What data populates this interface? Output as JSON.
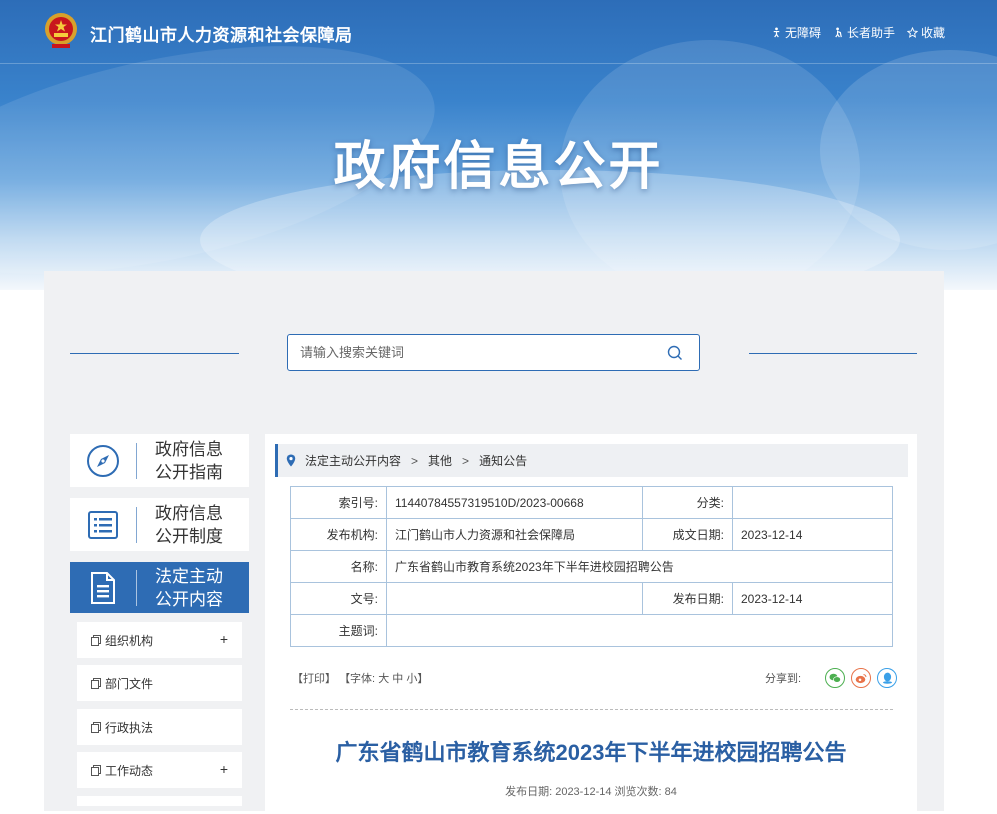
{
  "header": {
    "site_title": "江门鹤山市人力资源和社会保障局",
    "links": [
      {
        "icon": "accessibility-icon",
        "label": "无障碍"
      },
      {
        "icon": "elderly-icon",
        "label": "长者助手"
      },
      {
        "icon": "star-icon",
        "label": "收藏"
      }
    ],
    "hero_title": "政府信息公开"
  },
  "search": {
    "placeholder": "请输入搜索关键词"
  },
  "sidebar": {
    "cards": [
      {
        "label_line1": "政府信息",
        "label_line2": "公开指南",
        "icon": "compass-icon"
      },
      {
        "label_line1": "政府信息",
        "label_line2": "公开制度",
        "icon": "list-icon"
      },
      {
        "label_line1": "法定主动",
        "label_line2": "公开内容",
        "icon": "document-icon",
        "active": true
      }
    ],
    "items": [
      {
        "label": "组织机构",
        "expandable": "+"
      },
      {
        "label": "部门文件",
        "expandable": ""
      },
      {
        "label": "行政执法",
        "expandable": ""
      },
      {
        "label": "工作动态",
        "expandable": "+"
      }
    ]
  },
  "breadcrumb": [
    "法定主动公开内容",
    "其他",
    "通知公告"
  ],
  "meta": {
    "index_label": "索引号:",
    "index_value": "11440784557319510D/2023-00668",
    "category_label": "分类:",
    "category_value": "",
    "publisher_label": "发布机构:",
    "publisher_value": "江门鹤山市人力资源和社会保障局",
    "created_label": "成文日期:",
    "created_value": "2023-12-14",
    "name_label": "名称:",
    "name_value": "广东省鹤山市教育系统2023年下半年进校园招聘公告",
    "docno_label": "文号:",
    "docno_value": "",
    "pubdate_label": "发布日期:",
    "pubdate_value": "2023-12-14",
    "subject_label": "主题词:",
    "subject_value": ""
  },
  "tools": {
    "print": "【打印】",
    "font_prefix": "【字体:",
    "font_large": "大",
    "font_medium": "中",
    "font_small": "小",
    "font_suffix": "】",
    "share_label": "分享到:"
  },
  "article": {
    "title": "广东省鹤山市教育系统2023年下半年进校园招聘公告",
    "meta": "发布日期: 2023-12-14  浏览次数: 84"
  },
  "colors": {
    "primary": "#2e6cb4",
    "title_blue": "#2a5fa3",
    "wechat": "#4caf50",
    "weibo": "#e8734a",
    "qq": "#3aa0e8"
  }
}
